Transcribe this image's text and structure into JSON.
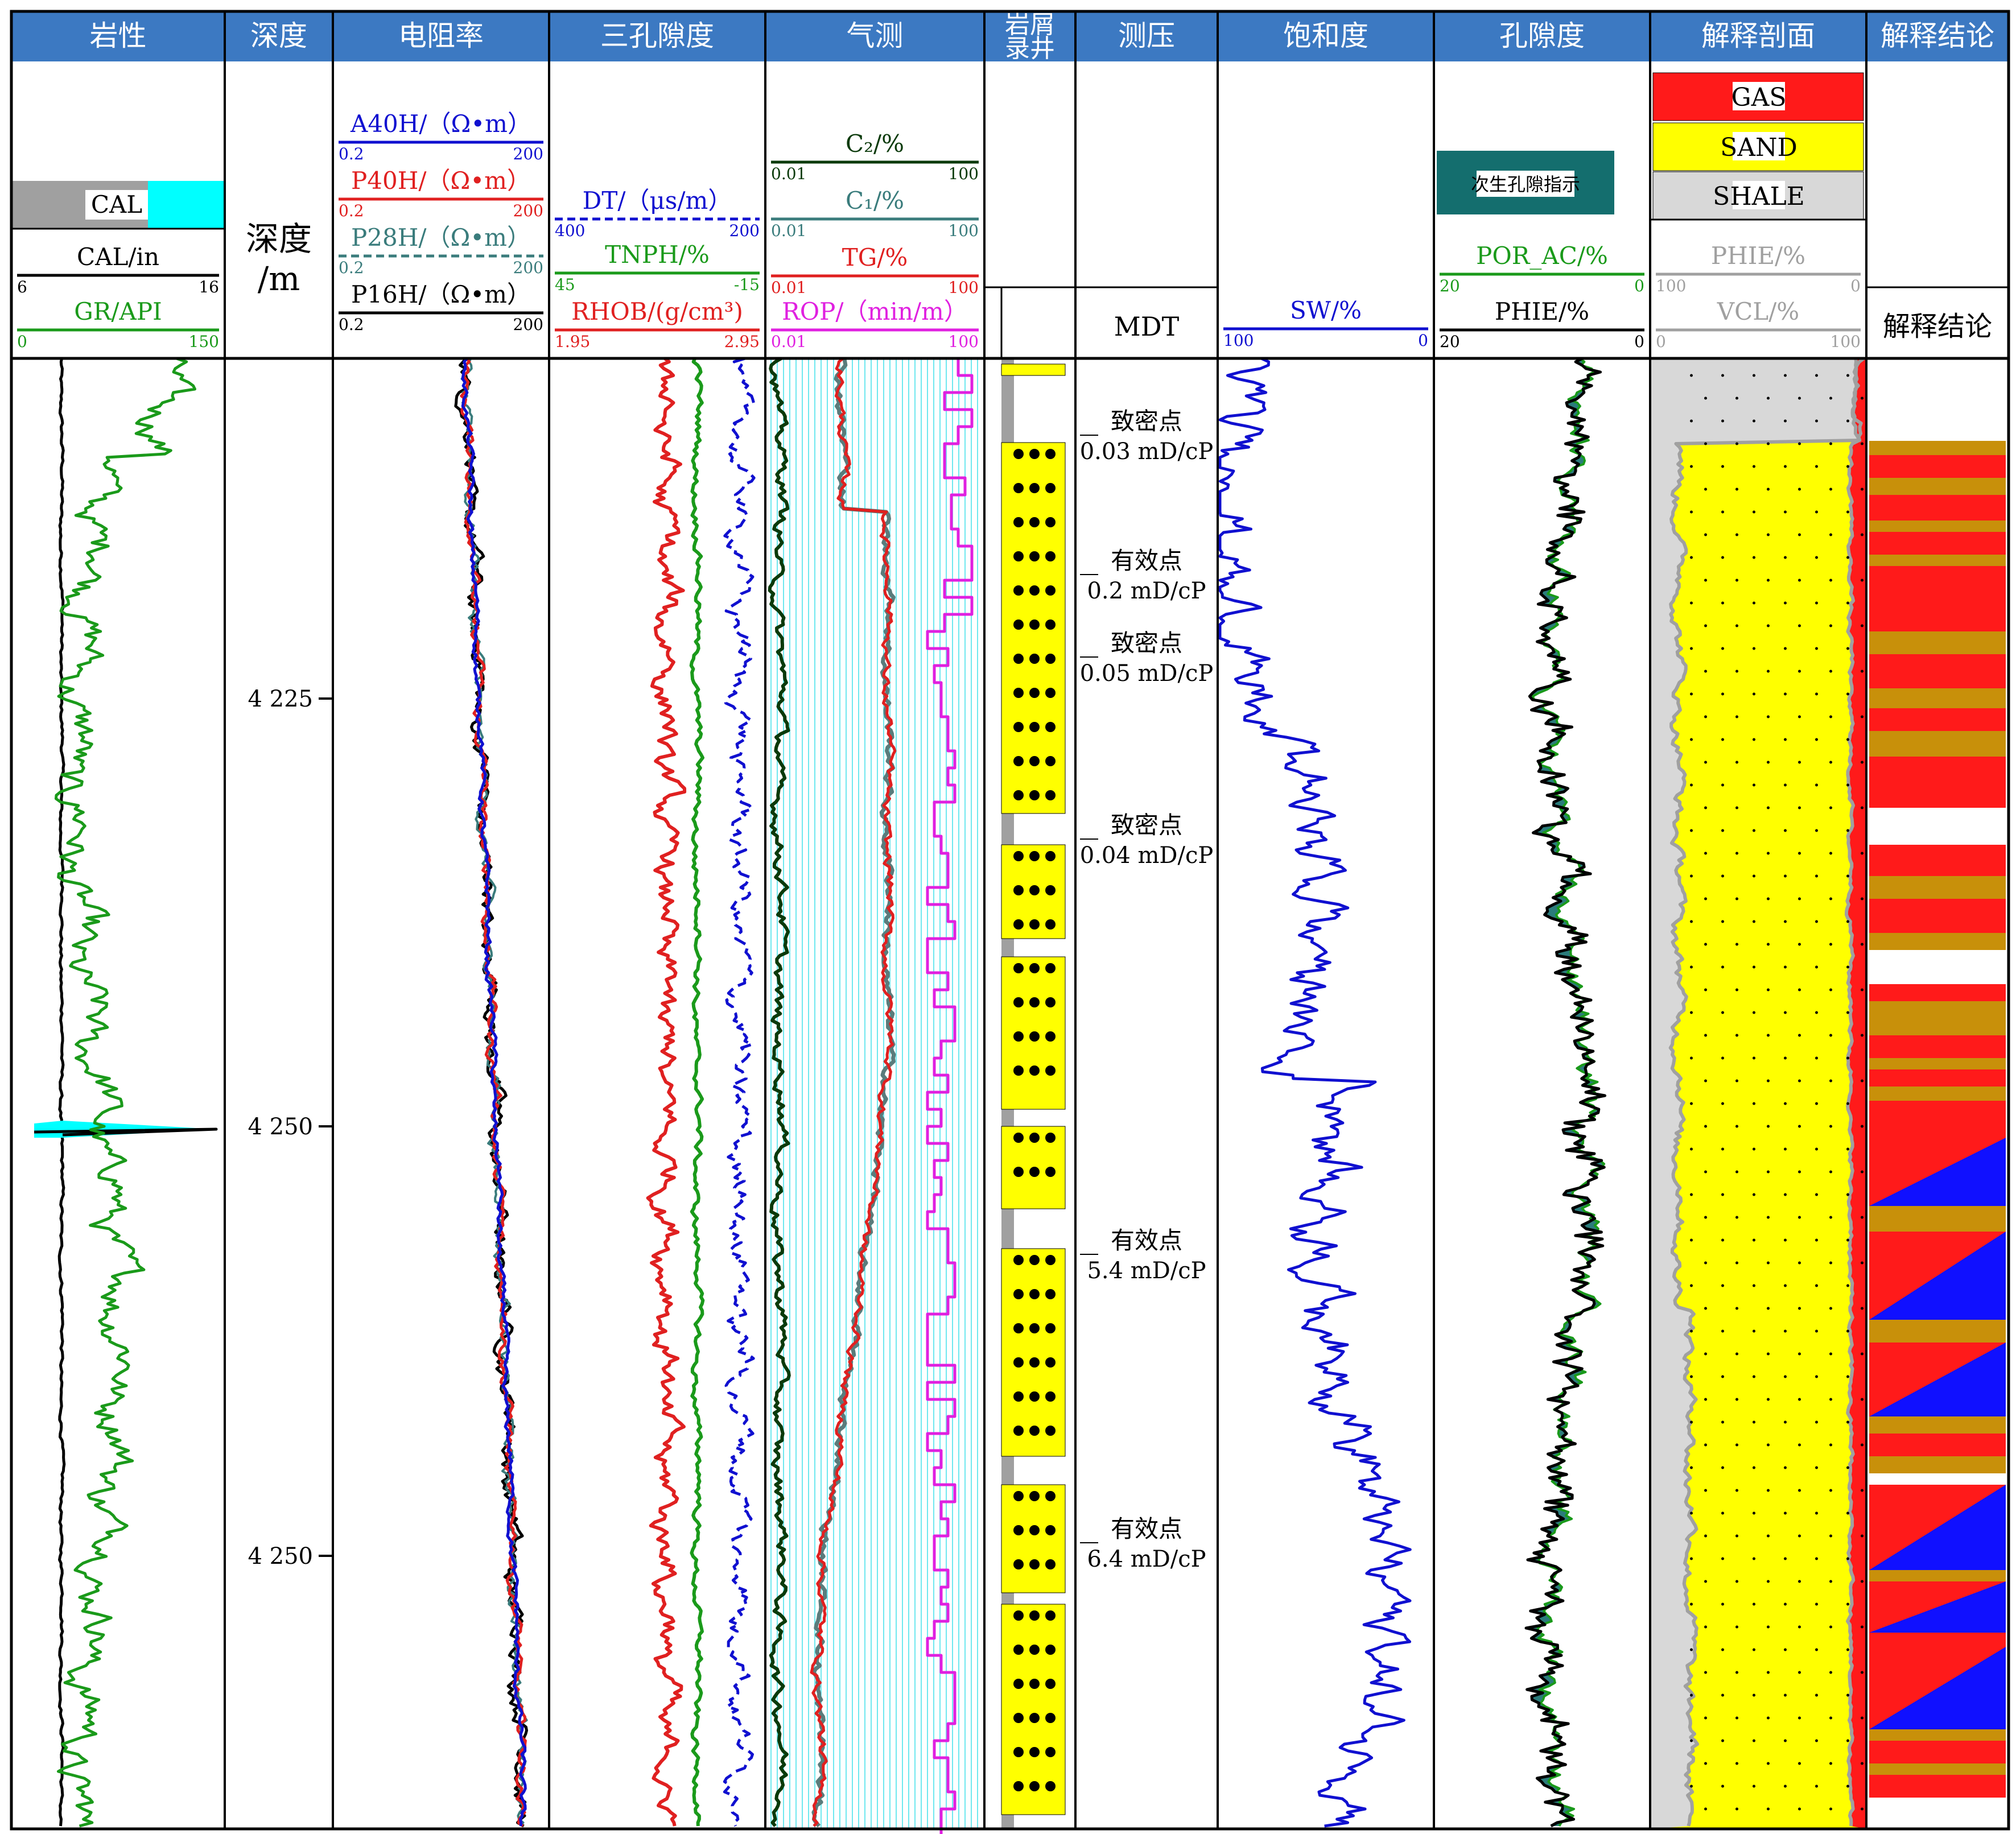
{
  "tracks": [
    {
      "key": "lith",
      "title": "岩性"
    },
    {
      "key": "depth",
      "title": "深度"
    },
    {
      "key": "res",
      "title": "电阻率"
    },
    {
      "key": "por3",
      "title": "三孔隙度"
    },
    {
      "key": "gas",
      "title": "气测"
    },
    {
      "key": "cut",
      "title": "岩屑录井"
    },
    {
      "key": "mdt",
      "title": "测压"
    },
    {
      "key": "sat",
      "title": "饱和度"
    },
    {
      "key": "por",
      "title": "孔隙度"
    },
    {
      "key": "prof",
      "title": "解释剖面"
    },
    {
      "key": "concl",
      "title": "解释结论"
    }
  ],
  "headers": {
    "lith": {
      "fill_label": "CAL",
      "curves": [
        {
          "name": "CAL/in",
          "min": "6",
          "max": "16",
          "color": "#000000"
        },
        {
          "name": "GR/API",
          "min": "0",
          "max": "150",
          "color": "#1a9a1a"
        }
      ]
    },
    "depth": {
      "label": "深度",
      "unit": "/m"
    },
    "res": {
      "curves": [
        {
          "name": "A40H/（Ω•m）",
          "min": "0.2",
          "max": "200",
          "color": "#1010d0"
        },
        {
          "name": "P40H/（Ω•m）",
          "min": "0.2",
          "max": "200",
          "color": "#e02020"
        },
        {
          "name": "P28H/（Ω•m）",
          "min": "0.2",
          "max": "200",
          "color": "#3a7c7c"
        },
        {
          "name": "P16H/（Ω•m）",
          "min": "0.2",
          "max": "200",
          "color": "#000000"
        }
      ]
    },
    "por3": {
      "curves": [
        {
          "name": "DT/（μs/m）",
          "min": "400",
          "max": "200",
          "color": "#1010d0"
        },
        {
          "name": "TNPH/%",
          "min": "45",
          "max": "-15",
          "color": "#1a9a1a"
        },
        {
          "name": "RHOB/(g/cm³)",
          "min": "1.95",
          "max": "2.95",
          "color": "#e02020"
        }
      ]
    },
    "gas": {
      "curves": [
        {
          "name": "C₂/%",
          "min": "0.01",
          "max": "100",
          "color": "#0a3a0a"
        },
        {
          "name": "C₁/%",
          "min": "0.01",
          "max": "100",
          "color": "#3a7c7c"
        },
        {
          "name": "TG/%",
          "min": "0.01",
          "max": "100",
          "color": "#e02020"
        },
        {
          "name": "ROP/（min/m）",
          "min": "0.01",
          "max": "100",
          "color": "#e020e0"
        }
      ]
    },
    "mdt": {
      "label": "MDT"
    },
    "sat": {
      "curves": [
        {
          "name": "SW/%",
          "min": "100",
          "max": "0",
          "color": "#1010d0"
        }
      ]
    },
    "por": {
      "badge": "次生孔隙指示",
      "curves": [
        {
          "name": "POR_AC/%",
          "min": "20",
          "max": "0",
          "color": "#1a9a1a"
        },
        {
          "name": "PHIE/%",
          "min": "20",
          "max": "0",
          "color": "#000000"
        }
      ]
    },
    "prof": {
      "legend": [
        "GAS",
        "SAND",
        "SHALE"
      ],
      "curves": [
        {
          "name": "PHIE/%",
          "min": "100",
          "max": "0",
          "color": "#a0a0a0"
        },
        {
          "name": "VCL/%",
          "min": "0",
          "max": "100",
          "color": "#a0a0a0"
        }
      ]
    },
    "concl": {
      "label": "解释结论"
    }
  },
  "depth_ticks": [
    "4 225",
    "4 250",
    "4 250"
  ],
  "mdt_points": [
    {
      "type": "致密点",
      "perm": "0.03 mD/cP"
    },
    {
      "type": "有效点",
      "perm": "0.2 mD/cP"
    },
    {
      "type": "致密点",
      "perm": "0.05 mD/cP"
    },
    {
      "type": "致密点",
      "perm": "0.04 mD/cP"
    },
    {
      "type": "有效点",
      "perm": "5.4 mD/cP"
    },
    {
      "type": "有效点",
      "perm": "6.4 mD/cP"
    }
  ],
  "colors": {
    "header_bg": "#3c79c2",
    "gas": "#ff1a1a",
    "sand": "#ffff00",
    "shale": "#d8d8d8",
    "teal": "#146e6e",
    "brown": "#c8900a",
    "blue": "#1010ff",
    "cyan": "#00ffff"
  }
}
